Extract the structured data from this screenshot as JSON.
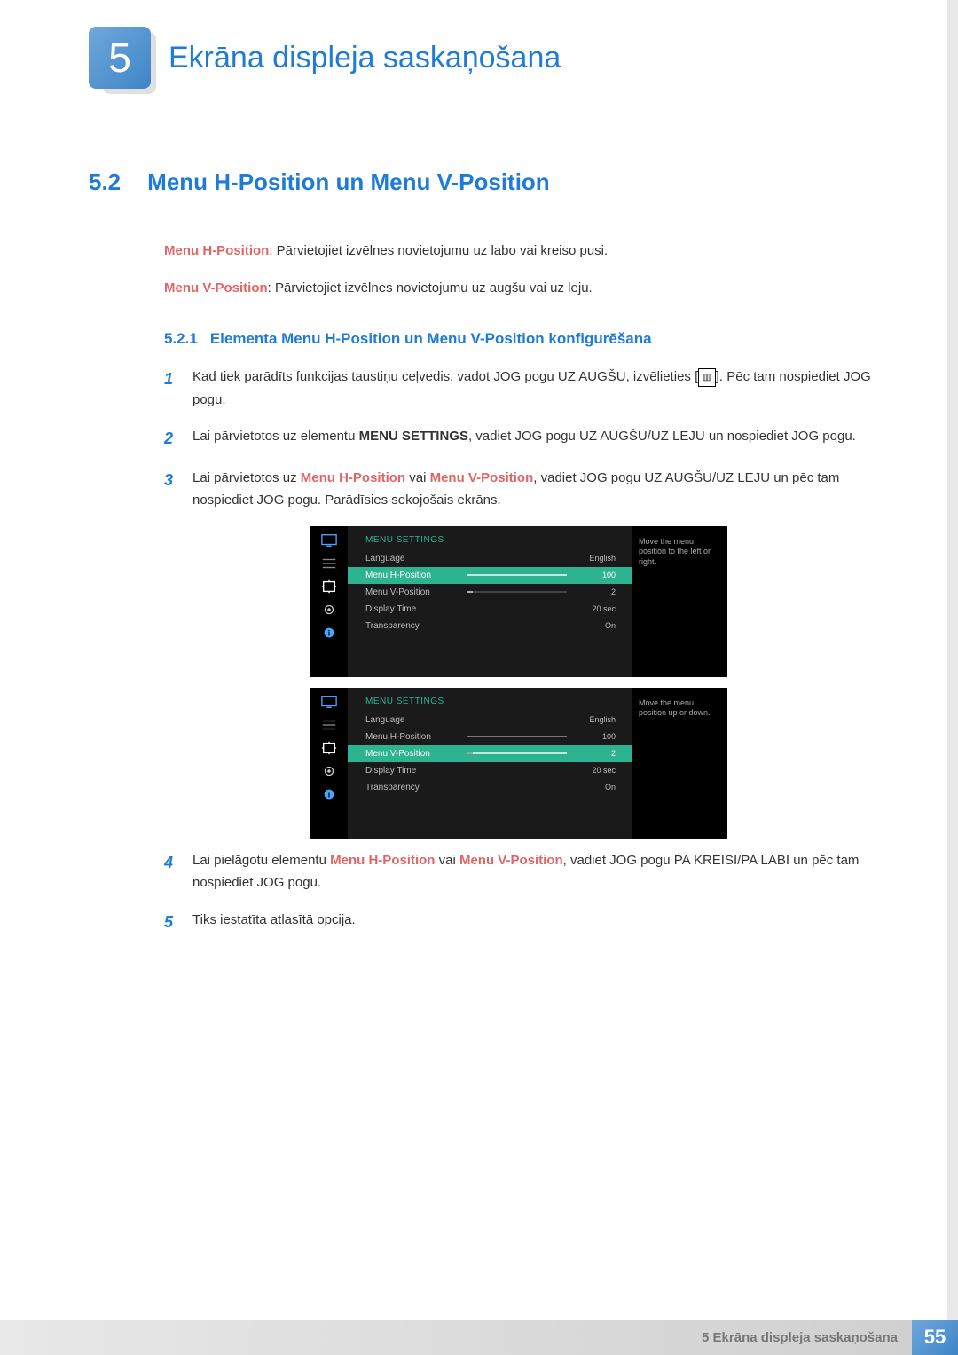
{
  "chapter": {
    "number": "5",
    "title": "Ekrāna displeja saskaņošana"
  },
  "section": {
    "number": "5.2",
    "title": "Menu H-Position un Menu V-Position"
  },
  "intro": {
    "h_label": "Menu H-Position",
    "h_text": ": Pārvietojiet izvēlnes novietojumu uz labo vai kreiso pusi.",
    "v_label": "Menu V-Position",
    "v_text": ": Pārvietojiet izvēlnes novietojumu uz augšu vai uz leju."
  },
  "subsection": {
    "number": "5.2.1",
    "title": "Elementa Menu H-Position un Menu V-Position konfigurēšana"
  },
  "steps": {
    "s1": {
      "num": "1",
      "a": "Kad tiek parādīts funkcijas taustiņu ceļvedis, vadot JOG pogu UZ AUGŠU, izvēlieties [",
      "b": "]. Pēc tam nospiediet JOG pogu."
    },
    "s2": {
      "num": "2",
      "a": "Lai pārvietotos uz elementu ",
      "bold": "MENU SETTINGS",
      "b": ", vadiet JOG pogu UZ AUGŠU/UZ LEJU un nospiediet JOG pogu."
    },
    "s3": {
      "num": "3",
      "a": "Lai pārvietotos uz ",
      "m1": "Menu H-Position",
      "mid": " vai ",
      "m2": "Menu V-Position",
      "b": ", vadiet JOG pogu UZ AUGŠU/UZ LEJU un pēc tam nospiediet JOG pogu. Parādīsies sekojošais ekrāns."
    },
    "s4": {
      "num": "4",
      "a": "Lai pielāgotu elementu ",
      "m1": "Menu H-Position",
      "mid": " vai ",
      "m2": "Menu V-Position",
      "b": ", vadiet JOG pogu PA KREISI/PA LABI un pēc tam nospiediet JOG pogu."
    },
    "s5": {
      "num": "5",
      "text": "Tiks iestatīta atlasītā opcija."
    }
  },
  "osd1": {
    "title": "MENU SETTINGS",
    "help": "Move the menu position to the left or right.",
    "rows": {
      "language": {
        "label": "Language",
        "value": "English"
      },
      "hpos": {
        "label": "Menu H-Position",
        "value": "100"
      },
      "vpos": {
        "label": "Menu V-Position",
        "value": "2"
      },
      "dtime": {
        "label": "Display Time",
        "value": "20 sec"
      },
      "trans": {
        "label": "Transparency",
        "value": "On"
      }
    }
  },
  "osd2": {
    "title": "MENU SETTINGS",
    "help": "Move the menu position up or down.",
    "rows": {
      "language": {
        "label": "Language",
        "value": "English"
      },
      "hpos": {
        "label": "Menu H-Position",
        "value": "100"
      },
      "vpos": {
        "label": "Menu V-Position",
        "value": "2"
      },
      "dtime": {
        "label": "Display Time",
        "value": "20 sec"
      },
      "trans": {
        "label": "Transparency",
        "value": "On"
      }
    }
  },
  "footer": {
    "text": "5 Ekrāna displeja saskaņošana",
    "page": "55"
  }
}
